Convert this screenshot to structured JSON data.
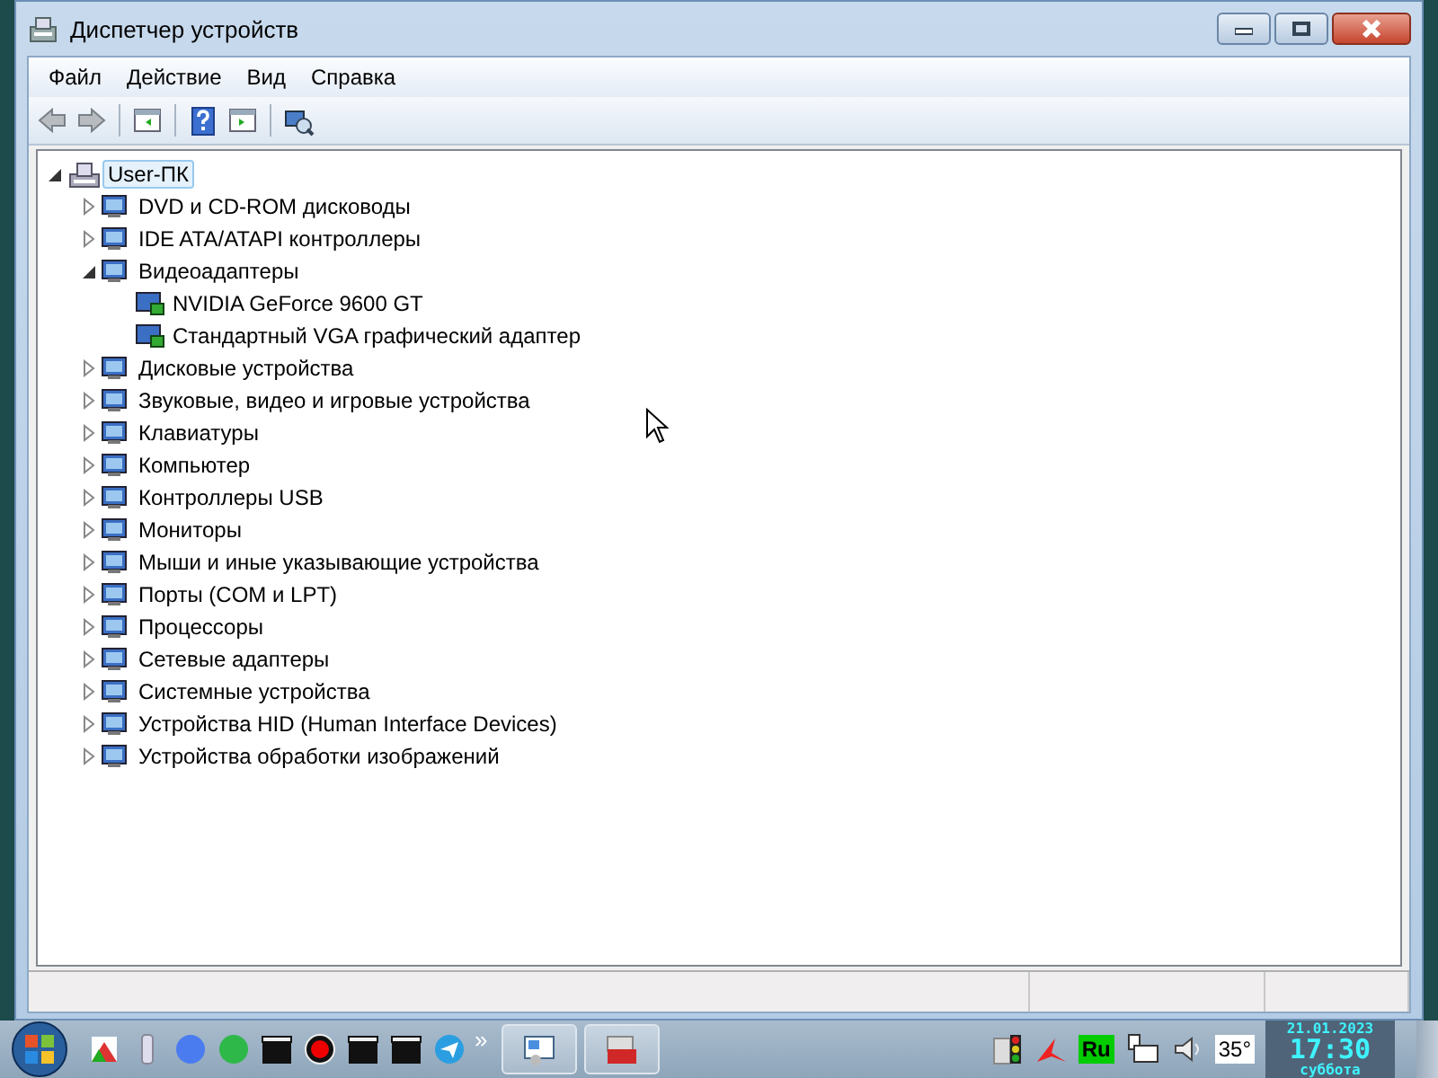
{
  "window": {
    "title": "Диспетчер устройств"
  },
  "menu": [
    {
      "label": "Файл"
    },
    {
      "label": "Действие"
    },
    {
      "label": "Вид"
    },
    {
      "label": "Справка"
    }
  ],
  "tree": {
    "label": "User-ПК",
    "expanded": true,
    "selected": true,
    "children": [
      {
        "label": "DVD и CD-ROM дисководы",
        "expanded": false,
        "selected": false
      },
      {
        "label": "IDE ATA/ATAPI контроллеры",
        "expanded": false,
        "selected": false
      },
      {
        "label": "Видеоадаптеры",
        "expanded": true,
        "selected": false,
        "children": [
          {
            "label": "NVIDIA GeForce 9600 GT",
            "selected": false
          },
          {
            "label": "Стандартный VGA графический адаптер",
            "selected": false
          }
        ]
      },
      {
        "label": "Дисковые устройства",
        "expanded": false,
        "selected": false
      },
      {
        "label": "Звуковые, видео и игровые устройства",
        "expanded": false,
        "selected": false
      },
      {
        "label": "Клавиатуры",
        "expanded": false,
        "selected": false
      },
      {
        "label": "Компьютер",
        "expanded": false,
        "selected": false
      },
      {
        "label": "Контроллеры USB",
        "expanded": false,
        "selected": false
      },
      {
        "label": "Мониторы",
        "expanded": false,
        "selected": false
      },
      {
        "label": "Мыши и иные указывающие устройства",
        "expanded": false,
        "selected": false
      },
      {
        "label": "Порты (COM и LPT)",
        "expanded": false,
        "selected": false
      },
      {
        "label": "Процессоры",
        "expanded": false,
        "selected": false
      },
      {
        "label": "Сетевые адаптеры",
        "expanded": false,
        "selected": false
      },
      {
        "label": "Системные устройства",
        "expanded": false,
        "selected": false
      },
      {
        "label": "Устройства HID (Human Interface Devices)",
        "expanded": false,
        "selected": false
      },
      {
        "label": "Устройства обработки изображений",
        "expanded": false,
        "selected": false
      }
    ]
  },
  "taskbar": {
    "overflow": "»",
    "tray": {
      "language": "Ru",
      "temperature": "35°",
      "date": "21.01.2023",
      "time": "17:30",
      "weekday": "суббота"
    }
  }
}
